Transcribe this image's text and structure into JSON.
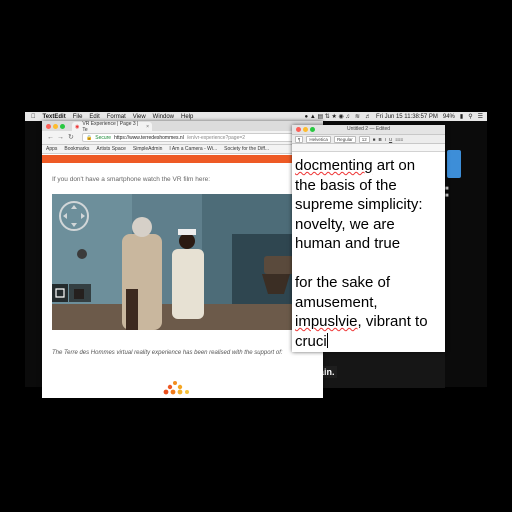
{
  "menubar": {
    "app_name": "TextEdit",
    "menus": [
      "File",
      "Edit",
      "Format",
      "View",
      "Window",
      "Help"
    ],
    "clock": "Fri Jun 15 11:38:57 PM",
    "battery": "94%"
  },
  "browser": {
    "tab_title": "VR Experience | Page 3 | Te",
    "url_secure_label": "Secure",
    "url_host": "https://www.terredeshommes.nl",
    "url_path": "/en/vr-experience?page=2",
    "bookmarks": [
      "Apps",
      "Bookmarks",
      "Artists Space",
      "SimpleAdmin",
      "I Am a Camera - Wi...",
      "Society for the Diff..."
    ],
    "page_text": "If you don't have a smartphone watch the VR film here:",
    "caption": "The Terre des Hommes virtual reality experience has been realised with the support of:"
  },
  "textedit": {
    "title": "Untitled 2 — Edited",
    "font_family": "Helvetica",
    "font_style": "Regular",
    "font_size": "12",
    "body_line1_word1": "docmenting",
    "body_line1_rest": " art on",
    "body_line2": "the basis of the",
    "body_line3": "supreme simplicity:",
    "body_line4": "novelty, we are",
    "body_line5": "human and true",
    "body_line7": "for the sake of",
    "body_line8": "amusement,",
    "body_line9_word1": "impuslvie",
    "body_line9_rest": ", vibrant to",
    "body_line10": "cruci"
  },
  "desktop": {
    "video_caption": "ain."
  },
  "colors": {
    "accent_orange": "#ee5a25",
    "secure_green": "#1a8a36",
    "menubar_bg": "#e8e8e8"
  }
}
